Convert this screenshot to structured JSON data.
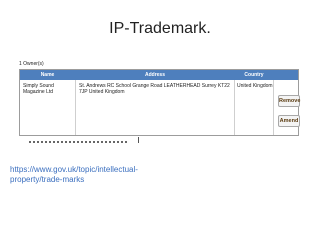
{
  "slide": {
    "title": "IP-Trademark.",
    "link_text": "https://www.gov.uk/topic/intellectual-property/trade-marks"
  },
  "owners": {
    "label": "1 Owner(s)",
    "columns": [
      "Name",
      "Address",
      "Country"
    ],
    "rows": [
      {
        "name": "Simply Sound Magazine Ltd",
        "address": "St. Andrews RC School Grange Road LEATHERHEAD Surrey KT22 7JP United Kingdom",
        "country": "United Kingdom"
      }
    ],
    "buttons": {
      "remove": "Remove",
      "amend": "Amend"
    }
  },
  "colors": {
    "header_bg": "#4e7fbd",
    "link": "#3b6fbf",
    "button_text": "#5b3c12"
  }
}
